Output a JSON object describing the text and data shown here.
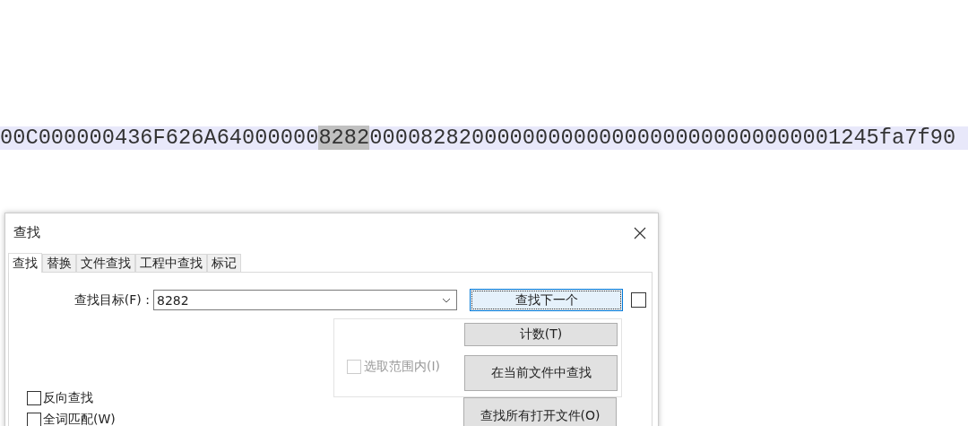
{
  "hex_line": {
    "before": "00C000000436F626A64000000",
    "match": "8282",
    "after": "0000828200000000000000000000000000001245fa7f90"
  },
  "dialog": {
    "title": "查找",
    "tabs": [
      {
        "label": "查找",
        "selected": true
      },
      {
        "label": "替换",
        "selected": false
      },
      {
        "label": "文件查找",
        "selected": false
      },
      {
        "label": "工程中查找",
        "selected": false
      },
      {
        "label": "标记",
        "selected": false
      }
    ],
    "find_target": {
      "label": "查找目标(F) :",
      "value": "8282"
    },
    "find_next_button": "查找下一个",
    "side_checkbox": {
      "checked": false
    },
    "count_button": "计数(T)",
    "in_selection": {
      "label": "选取范围内(I)",
      "checked": false,
      "disabled": true
    },
    "find_in_current_button": "在当前文件中查找",
    "find_all_open_button": "查找所有打开文件(O)",
    "options": [
      {
        "label": "反向查找",
        "checked": false
      },
      {
        "label": "全词匹配(W)",
        "checked": false
      }
    ]
  }
}
